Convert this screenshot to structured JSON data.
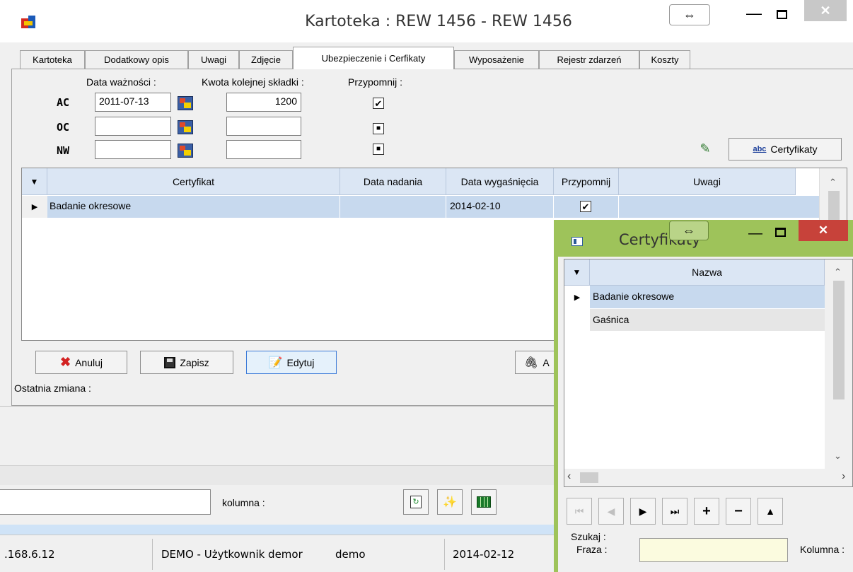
{
  "main_window": {
    "title": "Kartoteka : REW 1456 - REW 1456",
    "tabs": [
      "Kartoteka",
      "Dodatkowy opis",
      "Uwagi",
      "Zdjęcie",
      "Ubezpieczenie i Cerfikaty",
      "Wyposażenie",
      "Rejestr zdarzeń",
      "Koszty"
    ],
    "active_tab": "Ubezpieczenie i Cerfikaty"
  },
  "insurance": {
    "label_date": "Data ważności :",
    "label_amount": "Kwota kolejnej składki :",
    "label_remind": "Przypomnij :",
    "rows": [
      {
        "label": "AC",
        "date": "2011-07-13",
        "amount": "1200",
        "remind": "✔"
      },
      {
        "label": "OC",
        "date": "",
        "amount": "",
        "remind": "■"
      },
      {
        "label": "NW",
        "date": "",
        "amount": "",
        "remind": "■"
      }
    ],
    "cert_button": "Certyfikaty",
    "cert_button_icon": "abc"
  },
  "cert_grid": {
    "columns": [
      "Certyfikat",
      "Data nadania",
      "Data wygaśnięcia",
      "Przypomnij",
      "Uwagi"
    ],
    "rows": [
      {
        "certyfikat": "Badanie okresowe",
        "data_nadania": "",
        "data_wygasniecia": "2014-02-10",
        "przypomnij": "✔",
        "uwagi": ""
      }
    ]
  },
  "actions": {
    "cancel": "Anuluj",
    "save": "Zapisz",
    "edit": "Edytuj",
    "attach_partial": "A",
    "last_change": "Ostatnia zmiana :"
  },
  "bottom": {
    "column_label": "kolumna :"
  },
  "status_bar": {
    "ip": ".168.6.12",
    "user": "DEMO - Użytkownik demor",
    "login": "demo",
    "date": "2014-02-12"
  },
  "popup": {
    "title": "Certyfikaty",
    "column": "Nazwa",
    "items": [
      "Badanie okresowe",
      "Gaśnica"
    ],
    "search_label": "Szukaj :",
    "phrase_label": "Fraza :",
    "column_label": "Kolumna :",
    "phrase_value": ""
  },
  "colors": {
    "popup_border": "#9ec35a",
    "selected_row": "#c7d9ee",
    "grid_header": "#dbe6f4",
    "close_red": "#c7423a",
    "accent_blue": "#cfe3f7"
  }
}
